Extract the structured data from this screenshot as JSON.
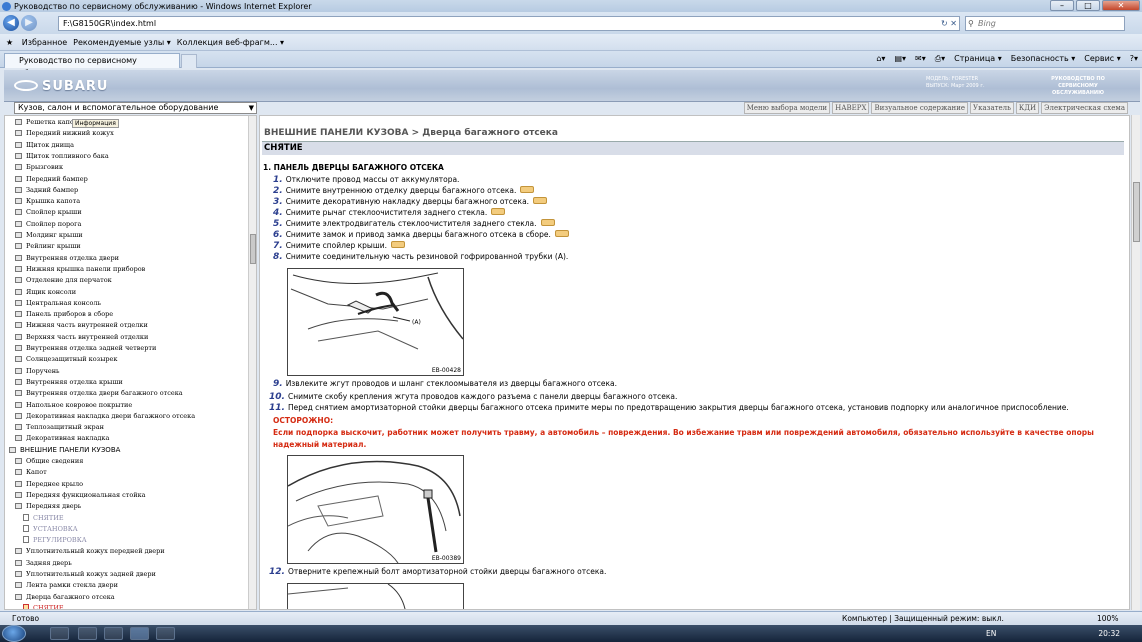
{
  "window": {
    "title": "Руководство по сервисному обслуживанию - Windows Internet Explorer"
  },
  "address": {
    "url": "F:\\G8150GR\\index.html",
    "search_placeholder": "Bing"
  },
  "favorites_bar": {
    "favorites": "Избранное",
    "recommended": "Рекомендуемые узлы ▾",
    "gallery": "Коллекция веб-фрагм... ▾"
  },
  "tab": {
    "title": "Руководство по сервисному обслуживанию"
  },
  "commands": {
    "page": "Страница ▾",
    "safety": "Безопасность ▾",
    "tools": "Сервис ▾",
    "help": "?▾"
  },
  "header": {
    "logo": "SUBARU",
    "model_line1": "МОДЕЛЬ: FORESTER",
    "model_line2": "ВЫПУСК: Март 2009 г.",
    "manual_line1": "РУКОВОДСТВО ПО",
    "manual_line2": "СЕРВИСНОМУ ОБСЛУЖИВАНИЮ"
  },
  "category_select": {
    "value": "Кузов, салон и вспомогательное оборудование"
  },
  "top_nav": [
    "Меню выбора модели",
    "НАВЕРХ",
    "Визуальное содержание",
    "Указатель",
    "КДИ",
    "Электрическая схема"
  ],
  "sidebar": {
    "tooltip": "Информация",
    "items": [
      {
        "label": "Решетка капота",
        "kind": "folder"
      },
      {
        "label": "Передний нижний кожух",
        "kind": "folder"
      },
      {
        "label": "Щиток днища",
        "kind": "folder"
      },
      {
        "label": "Щиток топливного бака",
        "kind": "folder"
      },
      {
        "label": "Брызговик",
        "kind": "folder"
      },
      {
        "label": "Передний бампер",
        "kind": "folder"
      },
      {
        "label": "Задний бампер",
        "kind": "folder"
      },
      {
        "label": "Крышка капота",
        "kind": "folder"
      },
      {
        "label": "Спойлер крыши",
        "kind": "folder"
      },
      {
        "label": "Спойлер порога",
        "kind": "folder"
      },
      {
        "label": "Молдинг крыши",
        "kind": "folder"
      },
      {
        "label": "Рейлинг крыши",
        "kind": "folder"
      },
      {
        "label": "Внутренняя отделка двери",
        "kind": "folder"
      },
      {
        "label": "Нижняя крышка панели приборов",
        "kind": "folder"
      },
      {
        "label": "Отделение для перчаток",
        "kind": "folder"
      },
      {
        "label": "Ящик консоли",
        "kind": "folder"
      },
      {
        "label": "Центральная консоль",
        "kind": "folder"
      },
      {
        "label": "Панель приборов в сборе",
        "kind": "folder"
      },
      {
        "label": "Нижняя часть внутренней отделки",
        "kind": "folder"
      },
      {
        "label": "Верхняя часть внутренней отделки",
        "kind": "folder"
      },
      {
        "label": "Внутренняя отделка задней четверти",
        "kind": "folder"
      },
      {
        "label": "Солнцезащитный козырек",
        "kind": "folder"
      },
      {
        "label": "Поручень",
        "kind": "folder"
      },
      {
        "label": "Внутренняя отделка крыши",
        "kind": "folder"
      },
      {
        "label": "Внутренняя отделка двери багажного отсека",
        "kind": "folder"
      },
      {
        "label": "Напольное ковровое покрытие",
        "kind": "folder"
      },
      {
        "label": "Декоративная накладка двери багажного отсека",
        "kind": "folder"
      },
      {
        "label": "Теплозащитный экран",
        "kind": "folder"
      },
      {
        "label": "Декоративная накладка",
        "kind": "folder"
      },
      {
        "label": "ВНЕШНИЕ ПАНЕЛИ КУЗОВА",
        "kind": "open"
      },
      {
        "label": "Общие сведения",
        "kind": "folder"
      },
      {
        "label": "Капот",
        "kind": "folder"
      },
      {
        "label": "Переднее крыло",
        "kind": "folder"
      },
      {
        "label": "Передняя функциональная стойка",
        "kind": "folder"
      },
      {
        "label": "Передняя дверь",
        "kind": "folder"
      },
      {
        "label": "СНЯТИЕ",
        "kind": "doc"
      },
      {
        "label": "УСТАНОВКА",
        "kind": "doc"
      },
      {
        "label": "РЕГУЛИРОВКА",
        "kind": "doc"
      },
      {
        "label": "Уплотнительный кожух передней двери",
        "kind": "folder"
      },
      {
        "label": "Задняя дверь",
        "kind": "folder"
      },
      {
        "label": "Уплотнительный кожух задней двери",
        "kind": "folder"
      },
      {
        "label": "Лента рамки стекла двери",
        "kind": "folder"
      },
      {
        "label": "Дверца багажного отсека",
        "kind": "folder"
      },
      {
        "label": "СНЯТИЕ",
        "kind": "doc-active"
      }
    ]
  },
  "content": {
    "breadcrumb": "ВНЕШНИЕ ПАНЕЛИ КУЗОВА > Дверца багажного отсека",
    "section": "СНЯТИЕ",
    "subtitle": "1. ПАНЕЛЬ ДВЕРЦЫ БАГАЖНОГО ОТСЕКА",
    "steps": [
      {
        "n": "1.",
        "text": "Отключите провод массы от аккумулятора.",
        "ref": false
      },
      {
        "n": "2.",
        "text": "Снимите внутреннюю отделку дверцы багажного отсека.",
        "ref": true
      },
      {
        "n": "3.",
        "text": "Снимите декоративную накладку дверцы багажного отсека.",
        "ref": true
      },
      {
        "n": "4.",
        "text": "Снимите рычаг стеклоочистителя заднего стекла.",
        "ref": true
      },
      {
        "n": "5.",
        "text": "Снимите электродвигатель стеклоочистителя заднего стекла.",
        "ref": true
      },
      {
        "n": "6.",
        "text": "Снимите замок и привод замка дверцы багажного отсека в сборе.",
        "ref": true
      },
      {
        "n": "7.",
        "text": "Снимите спойлер крыши.",
        "ref": true
      },
      {
        "n": "8.",
        "text": "Снимите соединительную часть резиновой гофрированной трубки (A).",
        "ref": false
      },
      {
        "n": "9.",
        "text": "Извлеките жгут проводов и шланг стеклоомывателя из дверцы багажного отсека.",
        "ref": false
      },
      {
        "n": "10.",
        "text": "Снимите скобу крепления жгута проводов каждого разъема с панели дверцы багажного отсека.",
        "ref": false
      },
      {
        "n": "11.",
        "text": "Перед снятием амортизаторной стойки дверцы багажного отсека примите меры по предотвращению закрытия дверцы багажного отсека, установив подпорку или аналогичное приспособление.",
        "ref": false
      },
      {
        "n": "12.",
        "text": "Отверните крепежный болт амортизаторной стойки дверцы багажного отсека.",
        "ref": false
      }
    ],
    "caution_title": "ОСТОРОЖНО:",
    "caution_text": "Если подпорка выскочит, работник может получить травму, а автомобиль – повреждения. Во избежание травм или повреждений автомобиля, обязательно используйте в качестве опоры надежный материал.",
    "fig1_caption": "EB-00428",
    "fig1_label": "(A)",
    "fig2_caption": "EB-00389"
  },
  "status": {
    "ready": "Готово",
    "zone": "Компьютер | Защищенный режим: выкл.",
    "zoom": "100%"
  },
  "taskbar": {
    "lang": "EN",
    "clock": "20:32"
  },
  "colors": {
    "step_number": "#2c3f8f",
    "caution": "#d52b12",
    "section_bar": "#d8dde8"
  }
}
